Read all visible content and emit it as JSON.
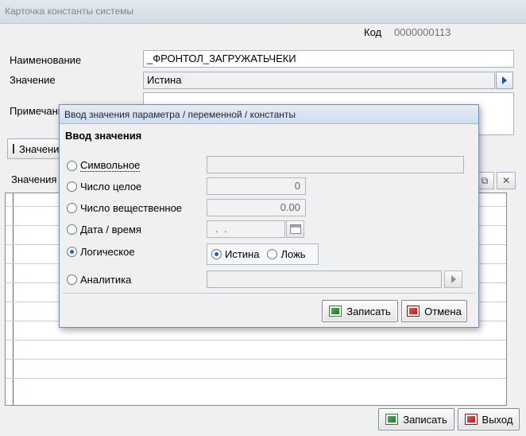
{
  "window": {
    "title": "Карточка константы системы",
    "code_label": "Код",
    "code_value": "0000000113"
  },
  "form": {
    "name_label": "Наименование",
    "name_value": "_ФРОНТОЛ_ЗАГРУЖАТЬЧЕКИ",
    "value_label": "Значение",
    "value_value": "Истина",
    "note_label": "Примечание",
    "note_value": "",
    "checkbox_label": "Значение",
    "values_label": "Значения"
  },
  "footer": {
    "save_label": "Записать",
    "exit_label": "Выход"
  },
  "dialog": {
    "title": "Ввод значения параметра / переменной / константы",
    "heading": "Ввод значения",
    "options": {
      "symbolic": "Символьное",
      "integer": "Число целое",
      "real": "Число вещественное",
      "datetime": "Дата / время",
      "logical": "Логическое",
      "analytic": "Аналитика"
    },
    "integer_value": "0",
    "real_value": "0.00",
    "date_value": ". .",
    "selected": "logical",
    "bool_true": "Истина",
    "bool_false": "Ложь",
    "bool_selected": "true",
    "save_label": "Записать",
    "cancel_label": "Отмена"
  }
}
